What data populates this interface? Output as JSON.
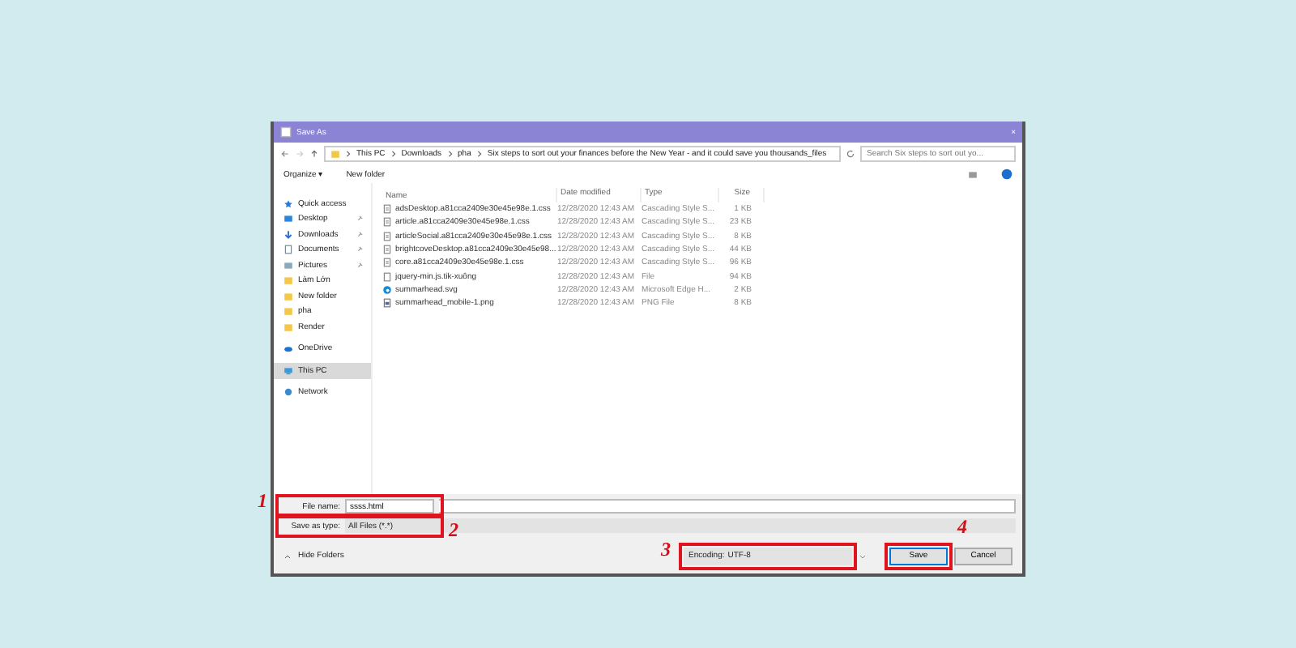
{
  "window": {
    "title": "Save As",
    "close": "×"
  },
  "address": {
    "path": [
      "This PC",
      "Downloads",
      "pha",
      "Six steps to sort out your finances before the New Year - and it could save you thousands_files"
    ],
    "search_placeholder": "Search Six steps to sort out yo..."
  },
  "toolbar": {
    "organize": "Organize ▾",
    "new_folder": "New folder"
  },
  "sidebar": {
    "items": [
      {
        "label": "Quick access",
        "kind": "star",
        "pinned": false,
        "selected": false
      },
      {
        "label": "Desktop",
        "kind": "desktop",
        "pinned": true,
        "selected": false
      },
      {
        "label": "Downloads",
        "kind": "download",
        "pinned": true,
        "selected": false
      },
      {
        "label": "Documents",
        "kind": "document",
        "pinned": true,
        "selected": false
      },
      {
        "label": "Pictures",
        "kind": "pictures",
        "pinned": true,
        "selected": false
      },
      {
        "label": "Làm Lớn",
        "kind": "folder",
        "pinned": false,
        "selected": false
      },
      {
        "label": "New folder",
        "kind": "folder",
        "pinned": false,
        "selected": false
      },
      {
        "label": "pha",
        "kind": "folder",
        "pinned": false,
        "selected": false
      },
      {
        "label": "Render",
        "kind": "folder",
        "pinned": false,
        "selected": false
      },
      {
        "label": "OneDrive",
        "kind": "cloud",
        "pinned": false,
        "selected": false
      },
      {
        "label": "This PC",
        "kind": "pc",
        "pinned": false,
        "selected": true
      },
      {
        "label": "Network",
        "kind": "network",
        "pinned": false,
        "selected": false
      }
    ]
  },
  "table": {
    "columns": [
      "Name",
      "Date modified",
      "Type",
      "Size"
    ],
    "rows": [
      {
        "name": "adsDesktop.a81cca2409e30e45e98e.1.css",
        "date": "12/28/2020 12:43 AM",
        "type": "Cascading Style S...",
        "size": "1 KB",
        "kind": "css"
      },
      {
        "name": "article.a81cca2409e30e45e98e.1.css",
        "date": "12/28/2020 12:43 AM",
        "type": "Cascading Style S...",
        "size": "23 KB",
        "kind": "css"
      },
      {
        "name": "articleSocial.a81cca2409e30e45e98e.1.css",
        "date": "12/28/2020 12:43 AM",
        "type": "Cascading Style S...",
        "size": "8 KB",
        "kind": "css"
      },
      {
        "name": "brightcoveDesktop.a81cca2409e30e45e98...",
        "date": "12/28/2020 12:43 AM",
        "type": "Cascading Style S...",
        "size": "44 KB",
        "kind": "css"
      },
      {
        "name": "core.a81cca2409e30e45e98e.1.css",
        "date": "12/28/2020 12:43 AM",
        "type": "Cascading Style S...",
        "size": "96 KB",
        "kind": "css"
      },
      {
        "name": "jquery-min.js.tik-xuông",
        "date": "12/28/2020 12:43 AM",
        "type": "File",
        "size": "94 KB",
        "kind": "file"
      },
      {
        "name": "summarhead.svg",
        "date": "12/28/2020 12:43 AM",
        "type": "Microsoft Edge H...",
        "size": "2 KB",
        "kind": "edge"
      },
      {
        "name": "summarhead_mobile-1.png",
        "date": "12/28/2020 12:43 AM",
        "type": "PNG File",
        "size": "8 KB",
        "kind": "png"
      }
    ]
  },
  "file_name": {
    "label": "File name:",
    "value": "ssss.html",
    "annotation": "1"
  },
  "save_type": {
    "label": "Save as type:",
    "value": "All Files (*.*)",
    "annotation": "2"
  },
  "hide_folders": "Hide Folders",
  "encoding": {
    "label": "Encoding:",
    "value": "UTF-8",
    "annotation": "3"
  },
  "buttons": [
    {
      "label": "Save",
      "kind": "primary",
      "annotation": "4"
    },
    {
      "label": "Cancel",
      "kind": "normal"
    }
  ]
}
